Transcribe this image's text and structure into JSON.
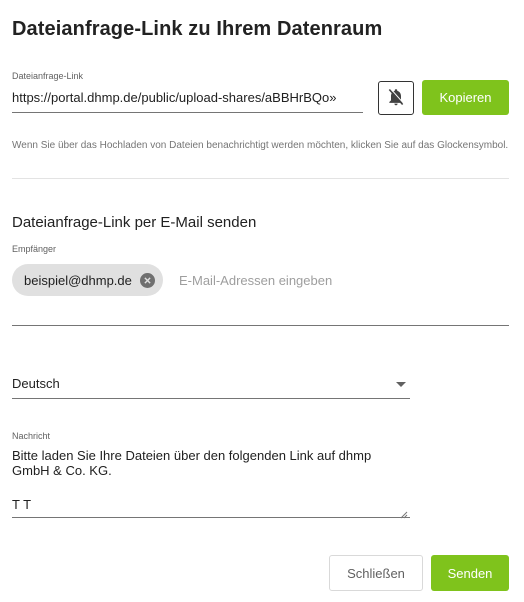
{
  "dialog": {
    "title": "Dateianfrage-Link zu Ihrem Datenraum"
  },
  "link": {
    "label": "Dateianfrage-Link",
    "value": "https://portal.dhmp.de/public/upload-shares/aBBHrBQo»",
    "notify_icon": "bell-off-icon",
    "copy_label": "Kopieren",
    "hint": "Wenn Sie über das Hochladen von Dateien benachrichtigt werden möchten, klicken Sie auf das Glockensymbol."
  },
  "email": {
    "section_title": "Dateianfrage-Link per E-Mail senden",
    "recipients_label": "Empfänger",
    "recipients": [
      "beispiel@dhmp.de"
    ],
    "recipient_placeholder": "E-Mail-Adressen eingeben",
    "language": "Deutsch",
    "message_label": "Nachricht",
    "message_line1": "Bitte laden Sie Ihre Dateien über den folgenden Link auf dhmp GmbH & Co. KG.",
    "message_signature": "T T"
  },
  "footer": {
    "close_label": "Schließen",
    "send_label": "Senden"
  },
  "colors": {
    "accent": "#7fc31c",
    "chip_bg": "#e0e0e0"
  }
}
